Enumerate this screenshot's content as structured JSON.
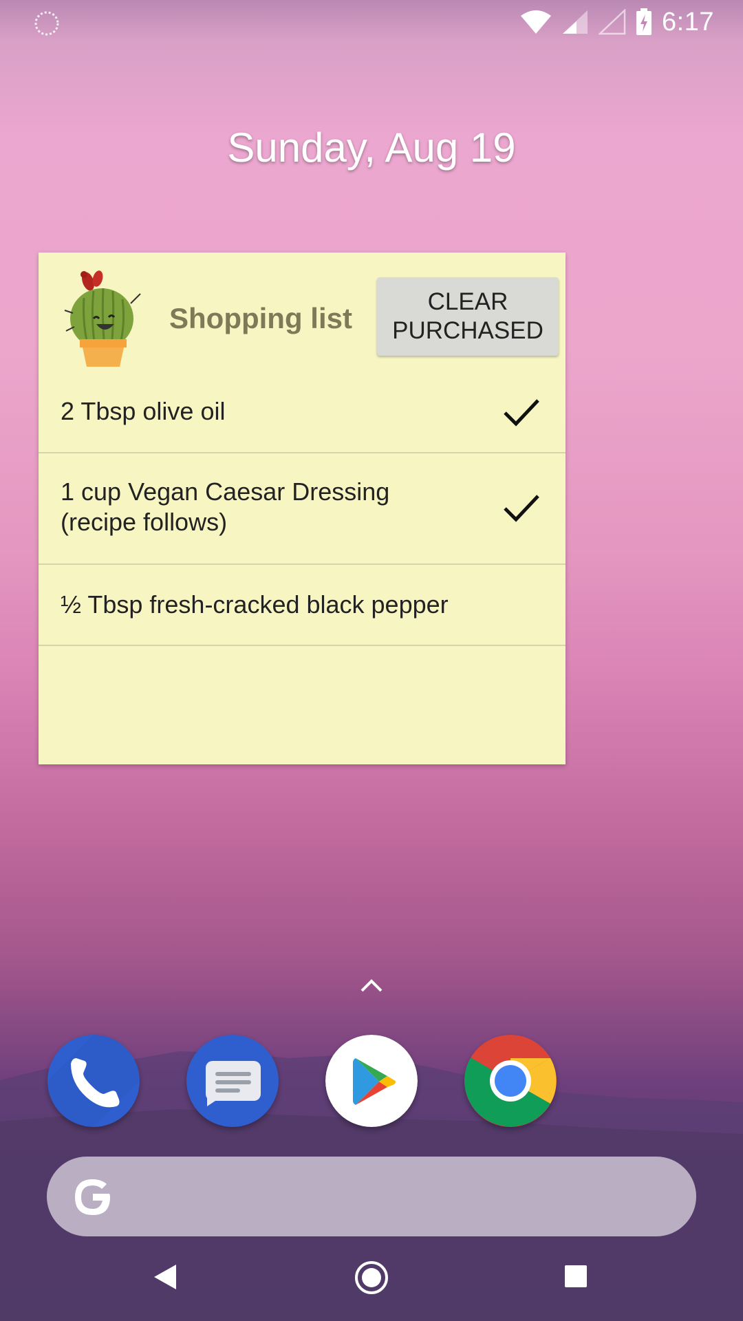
{
  "status_bar": {
    "time": "6:17",
    "icons": [
      "sync-icon",
      "wifi-icon",
      "signal-icon",
      "no-signal-icon",
      "battery-charging-icon"
    ]
  },
  "date_text": "Sunday, Aug 19",
  "widget": {
    "title": "Shopping list",
    "clear_button": {
      "line1": "CLEAR",
      "line2": "PURCHASED"
    },
    "items": [
      {
        "line1": "2 Tbsp olive oil",
        "line2": "",
        "checked": true
      },
      {
        "line1": "1 cup Vegan Caesar Dressing",
        "line2": "(recipe follows)",
        "checked": true
      },
      {
        "line1": "½ Tbsp fresh-cracked black pepper",
        "line2": "",
        "checked": false
      }
    ],
    "colors": {
      "background": "#f7f5c2",
      "title": "#7e7a58"
    }
  },
  "dock": {
    "apps": [
      "phone-icon",
      "messages-icon",
      "play-store-icon",
      "chrome-icon"
    ]
  },
  "search": {
    "icon": "google-g-icon"
  },
  "navigation": {
    "buttons": [
      "back-icon",
      "home-icon",
      "recents-icon"
    ]
  }
}
